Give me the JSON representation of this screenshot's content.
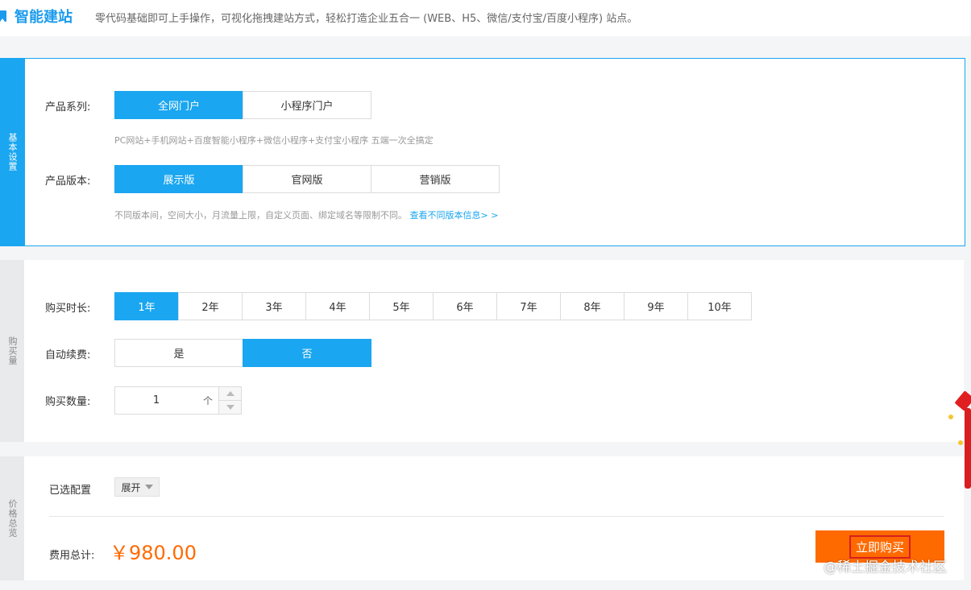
{
  "header": {
    "title": "智能建站",
    "description": "零代码基础即可上手操作，可视化拖拽建站方式，轻松打造企业五合一 (WEB、H5、微信/支付宝/百度小程序) 站点。"
  },
  "tabs": {
    "basic": "基本设置",
    "purchase": "购买量",
    "price": "价格总览"
  },
  "basic": {
    "series_label": "产品系列:",
    "series_options": [
      "全网门户",
      "小程序门户"
    ],
    "series_selected": 0,
    "series_hint": "PC网站+手机网站+百度智能小程序+微信小程序+支付宝小程序 五端一次全搞定",
    "version_label": "产品版本:",
    "version_options": [
      "展示版",
      "官网版",
      "营销版"
    ],
    "version_selected": 0,
    "version_hint": "不同版本间，空间大小，月流量上限，自定义页面、绑定域名等限制不同。",
    "version_link": "查看不同版本信息> >"
  },
  "purchase": {
    "duration_label": "购买时长:",
    "duration_options": [
      "1年",
      "2年",
      "3年",
      "4年",
      "5年",
      "6年",
      "7年",
      "8年",
      "9年",
      "10年"
    ],
    "duration_selected": 0,
    "renew_label": "自动续费:",
    "renew_options": [
      "是",
      "否"
    ],
    "renew_selected": 1,
    "quantity_label": "购买数量:",
    "quantity_value": "1",
    "quantity_unit": "个"
  },
  "summary": {
    "selected_label": "已选配置",
    "expand_label": "展开",
    "total_label": "费用总计:",
    "total_value": "￥980.00",
    "buy_label": "立即购买"
  },
  "watermark": "@稀土掘金技术社区",
  "colors": {
    "primary": "#1aa6f0",
    "accent": "#ff6a00",
    "button_outline": "#d62020"
  }
}
